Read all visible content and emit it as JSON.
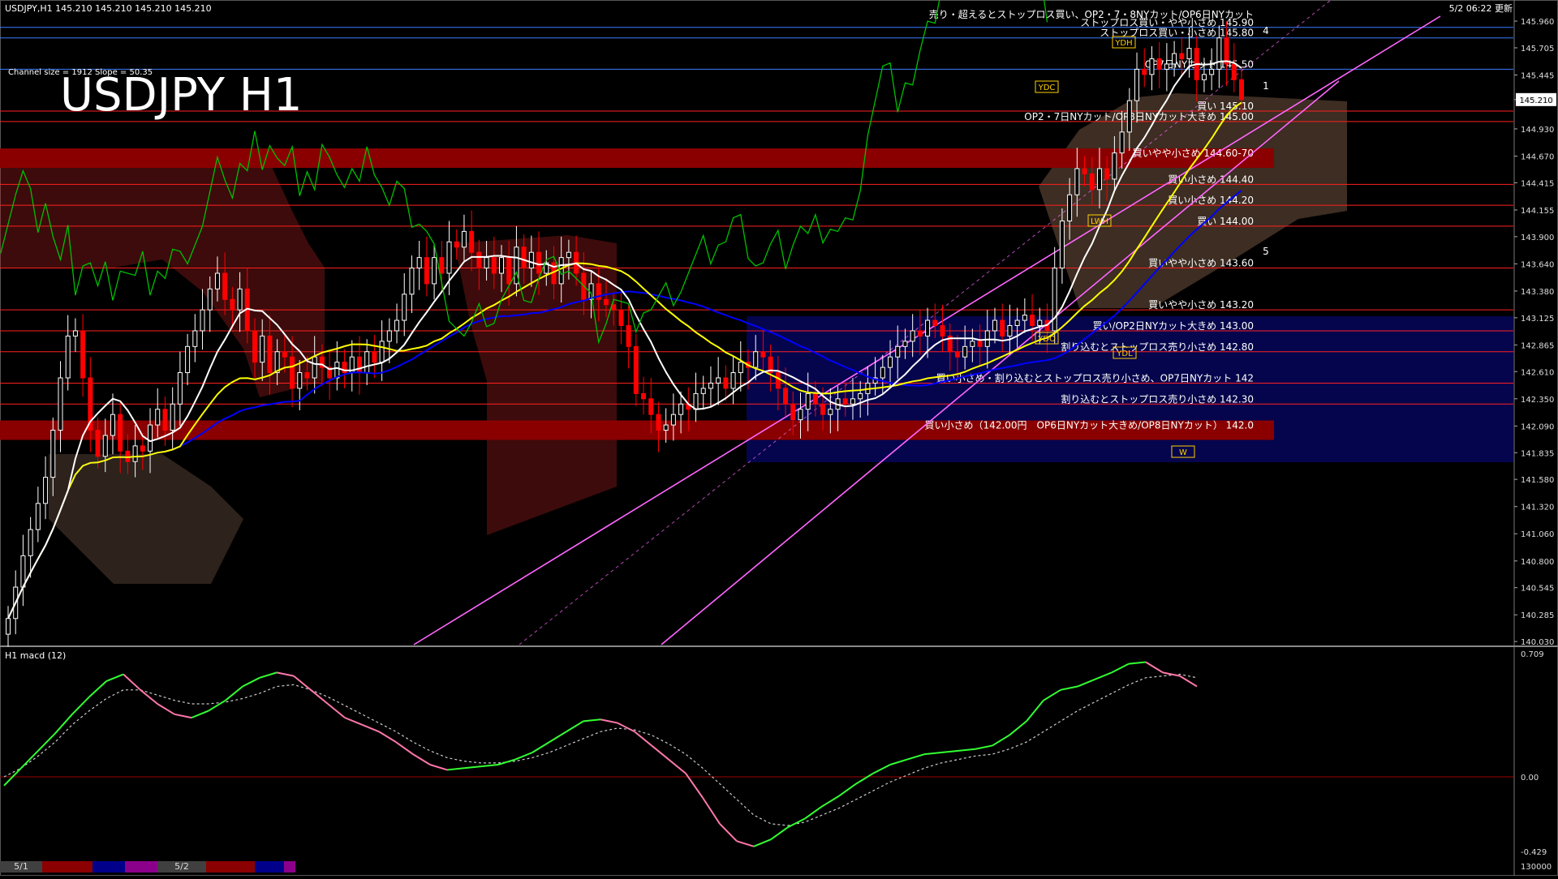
{
  "header": {
    "symbol_line": "USDJPY,H1  145.210 145.210 145.210 145.210",
    "updated": "5/2 06:22 更新",
    "channel_info": "Channel size = 1912 Slope = 50.35",
    "big_title": "USDJPY H1",
    "macd_label": "H1  macd (12)"
  },
  "colors": {
    "background": "#000000",
    "bull": "#ffffff",
    "bear": "#ff0000",
    "ma_white": "#ffffff",
    "ma_yellow": "#ffff00",
    "ma_blue": "#0000ff",
    "chikou": "#00c000",
    "channel": "#ff66ff",
    "band": "#b00000",
    "macd_up": "#33ff33",
    "macd_down": "#ff77aa",
    "signal": "#cccccc",
    "level_red": "#ff2020",
    "level_blue": "#3b7bff"
  },
  "chart_data": {
    "type": "candlestick",
    "symbol": "USDJPY",
    "timeframe": "H1",
    "ylim": [
      140.0,
      146.1
    ],
    "y_ticks": [
      "145.960",
      "145.705",
      "145.445",
      "145.210",
      "144.930",
      "144.670",
      "144.415",
      "144.155",
      "143.900",
      "143.640",
      "143.380",
      "143.125",
      "142.865",
      "142.610",
      "142.350",
      "142.090",
      "141.835",
      "141.580",
      "141.320",
      "141.060",
      "140.800",
      "140.545",
      "140.285",
      "140.030"
    ],
    "current_price": "145.210",
    "date_labels": [
      "5/1",
      "5/2"
    ],
    "closes": [
      140.25,
      140.55,
      140.85,
      141.1,
      141.35,
      141.6,
      142.05,
      142.55,
      142.95,
      143.0,
      142.55,
      142.05,
      141.8,
      142.0,
      142.2,
      141.85,
      141.75,
      141.9,
      141.85,
      142.1,
      142.25,
      142.05,
      142.3,
      142.6,
      142.85,
      143.0,
      143.2,
      143.4,
      143.55,
      143.3,
      143.2,
      143.4,
      143.0,
      142.7,
      142.95,
      142.6,
      142.8,
      142.75,
      142.45,
      142.6,
      142.55,
      142.75,
      142.65,
      142.55,
      142.7,
      142.6,
      142.75,
      142.6,
      142.8,
      142.7,
      142.9,
      143.0,
      143.1,
      143.35,
      143.6,
      143.7,
      143.45,
      143.7,
      143.55,
      143.85,
      143.8,
      143.95,
      143.75,
      143.6,
      143.7,
      143.55,
      143.7,
      143.45,
      143.8,
      143.6,
      143.75,
      143.55,
      143.65,
      143.45,
      143.7,
      143.75,
      143.55,
      143.3,
      143.45,
      143.3,
      143.25,
      143.2,
      143.05,
      142.85,
      142.4,
      142.35,
      142.2,
      142.05,
      142.1,
      142.2,
      142.3,
      142.25,
      142.4,
      142.45,
      142.5,
      142.55,
      142.45,
      142.6,
      142.7,
      142.65,
      142.8,
      142.75,
      142.6,
      142.45,
      142.3,
      142.15,
      142.25,
      142.4,
      142.3,
      142.2,
      142.25,
      142.35,
      142.3,
      142.35,
      142.4,
      142.5,
      142.55,
      142.65,
      142.75,
      142.85,
      142.9,
      143.0,
      142.95,
      143.1,
      143.05,
      142.95,
      142.8,
      142.75,
      142.85,
      142.9,
      142.85,
      143.0,
      143.1,
      142.95,
      143.05,
      143.1,
      143.15,
      143.05,
      143.1,
      143.0,
      143.6,
      144.05,
      144.3,
      144.55,
      144.5,
      144.35,
      144.55,
      144.45,
      144.7,
      144.9,
      145.2,
      145.5,
      145.45,
      145.6,
      145.5,
      145.55,
      145.65,
      145.6,
      145.7,
      145.4,
      145.45,
      145.5,
      145.8,
      145.55,
      145.4,
      145.21
    ],
    "lines": [
      {
        "label": "売り・超えるとストップロス買い、OP2・7・8NYカット/OP6日NYカット",
        "color": "#ffffff"
      },
      {
        "label": "ストップロス買い・やや小さめ 145.90",
        "price": 145.9,
        "color": "#3b7bff"
      },
      {
        "label": "ストップロス買い・小さめ 145.80",
        "price": 145.8,
        "color": "#3b7bff"
      },
      {
        "label": "OP7日NYカット 145.50",
        "price": 145.5,
        "color": "#3b7bff"
      },
      {
        "label": "買い 145.10",
        "price": 145.1,
        "color": "#ff2020"
      },
      {
        "label": "OP2・7日NYカット/OP8日NYカット大きめ 145.00",
        "price": 145.0,
        "color": "#ff2020"
      },
      {
        "label": "買いやや小さめ 144.60-70",
        "price": 144.65,
        "color": "#b00000"
      },
      {
        "label": "買い小さめ 144.40",
        "price": 144.4,
        "color": "#ff2020"
      },
      {
        "label": "買い小さめ 144.20",
        "price": 144.2,
        "color": "#ff2020"
      },
      {
        "label": "買い 144.00",
        "price": 144.0,
        "color": "#ff2020"
      },
      {
        "label": "買いやや小さめ 143.60",
        "price": 143.6,
        "color": "#ff2020"
      },
      {
        "label": "買いやや小さめ 143.20",
        "price": 143.2,
        "color": "#ff2020"
      },
      {
        "label": "買い/OP2日NYカット大きめ 143.00",
        "price": 143.0,
        "color": "#ff2020"
      },
      {
        "label": "割り込むとストップロス売り小さめ 142.80",
        "price": 142.8,
        "color": "#ff2020"
      },
      {
        "label": "買い小さめ・割り込むとストップロス売り小さめ、OP7日NYカット 142",
        "price": 142.5,
        "color": "#ff2020"
      },
      {
        "label": "割り込むとストップロス売り小さめ 142.30",
        "price": 142.3,
        "color": "#ff2020"
      },
      {
        "label": "買い小さめ（142.00円　OP6日NYカット大きめ/OP8日NYカット） 142.0",
        "price": 142.05,
        "color": "#b00000"
      }
    ],
    "markers": [
      "YDH",
      "YDC",
      "YDO",
      "YDL",
      "LWH",
      "W",
      "1",
      "4",
      "5"
    ],
    "macd": {
      "ylim": [
        -0.429,
        0.709
      ],
      "ticks": [
        "0.709",
        "0.00",
        "-0.429"
      ],
      "values": [
        -0.05,
        0.05,
        0.15,
        0.25,
        0.36,
        0.46,
        0.55,
        0.59,
        0.5,
        0.42,
        0.36,
        0.34,
        0.38,
        0.44,
        0.52,
        0.57,
        0.6,
        0.58,
        0.5,
        0.42,
        0.34,
        0.3,
        0.26,
        0.2,
        0.13,
        0.07,
        0.04,
        0.05,
        0.06,
        0.07,
        0.1,
        0.14,
        0.2,
        0.26,
        0.32,
        0.33,
        0.31,
        0.26,
        0.18,
        0.1,
        0.02,
        -0.12,
        -0.27,
        -0.37,
        -0.4,
        -0.36,
        -0.29,
        -0.24,
        -0.17,
        -0.11,
        -0.04,
        0.02,
        0.07,
        0.1,
        0.13,
        0.14,
        0.15,
        0.16,
        0.18,
        0.24,
        0.32,
        0.44,
        0.5,
        0.52,
        0.56,
        0.6,
        0.65,
        0.66,
        0.6,
        0.58,
        0.52
      ],
      "signal": [
        0.0,
        0.05,
        0.12,
        0.2,
        0.3,
        0.38,
        0.45,
        0.5,
        0.5,
        0.47,
        0.44,
        0.42,
        0.42,
        0.43,
        0.45,
        0.48,
        0.52,
        0.53,
        0.5,
        0.46,
        0.41,
        0.36,
        0.31,
        0.26,
        0.2,
        0.15,
        0.11,
        0.09,
        0.08,
        0.08,
        0.09,
        0.11,
        0.14,
        0.18,
        0.22,
        0.26,
        0.28,
        0.27,
        0.24,
        0.19,
        0.13,
        0.05,
        -0.04,
        -0.13,
        -0.22,
        -0.27,
        -0.28,
        -0.26,
        -0.22,
        -0.18,
        -0.13,
        -0.08,
        -0.03,
        0.01,
        0.05,
        0.08,
        0.1,
        0.12,
        0.13,
        0.16,
        0.2,
        0.26,
        0.32,
        0.38,
        0.43,
        0.48,
        0.53,
        0.57,
        0.58,
        0.59,
        0.57
      ],
      "bottom_value": "130000"
    }
  }
}
